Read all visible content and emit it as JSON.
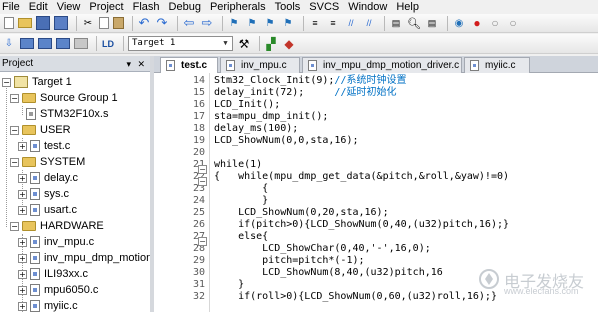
{
  "menu": [
    "File",
    "Edit",
    "View",
    "Project",
    "Flash",
    "Debug",
    "Peripherals",
    "Tools",
    "SVCS",
    "Window",
    "Help"
  ],
  "toolbar": {
    "target_value": "Target 1"
  },
  "project_panel": {
    "title": "Project",
    "root": "Target 1",
    "groups": [
      {
        "name": "Source Group 1",
        "files": [
          "STM32F10x.s"
        ]
      },
      {
        "name": "USER",
        "files": [
          "test.c"
        ]
      },
      {
        "name": "SYSTEM",
        "files": [
          "delay.c",
          "sys.c",
          "usart.c"
        ]
      },
      {
        "name": "HARDWARE",
        "files": [
          "inv_mpu.c",
          "inv_mpu_dmp_motion",
          "ILI93xx.c",
          "mpu6050.c",
          "myiic.c"
        ]
      }
    ]
  },
  "tabs": [
    "test.c",
    "inv_mpu.c",
    "inv_mpu_dmp_motion_driver.c",
    "myiic.c"
  ],
  "active_tab": "test.c",
  "code_lines": [
    {
      "n": "14",
      "code": "Stm32_Clock_Init(9);",
      "comment": "//系统时钟设置"
    },
    {
      "n": "15",
      "code": "delay_init(72);     ",
      "comment": "//延时初始化"
    },
    {
      "n": "16",
      "code": "LCD_Init();",
      "comment": ""
    },
    {
      "n": "17",
      "code": "sta=mpu_dmp_init();",
      "comment": ""
    },
    {
      "n": "18",
      "code": "delay_ms(100);",
      "comment": ""
    },
    {
      "n": "19",
      "code": "LCD_ShowNum(0,0,sta,16);",
      "comment": ""
    },
    {
      "n": "20",
      "code": "",
      "comment": ""
    },
    {
      "n": "21",
      "code": "while(1)",
      "comment": ""
    },
    {
      "n": "22",
      "code": "{   while(mpu_dmp_get_data(&pitch,&roll,&yaw)!=0)",
      "comment": ""
    },
    {
      "n": "23",
      "code": "        {",
      "comment": ""
    },
    {
      "n": "24",
      "code": "        }",
      "comment": ""
    },
    {
      "n": "25",
      "code": "    LCD_ShowNum(0,20,sta,16);",
      "comment": ""
    },
    {
      "n": "26",
      "code": "    if(pitch>0){LCD_ShowNum(0,40,(u32)pitch,16);}",
      "comment": ""
    },
    {
      "n": "27",
      "code": "    else{",
      "comment": ""
    },
    {
      "n": "28",
      "code": "        LCD_ShowChar(0,40,'-',16,0);",
      "comment": ""
    },
    {
      "n": "29",
      "code": "        pitch=pitch*(-1);",
      "comment": ""
    },
    {
      "n": "30",
      "code": "        LCD_ShowNum(8,40,(u32)pitch,16 ",
      "comment": ""
    },
    {
      "n": "31",
      "code": "    }",
      "comment": ""
    },
    {
      "n": "32",
      "code": "    if(roll>0){LCD_ShowNum(0,60,(u32)roll,16);}",
      "comment": ""
    }
  ],
  "watermark": {
    "text": "电子发烧友",
    "url": "www.elecfans.com"
  },
  "colors": {
    "comment": "#0071c5",
    "keyword": "#00008b",
    "folder": "#e8c45c"
  }
}
